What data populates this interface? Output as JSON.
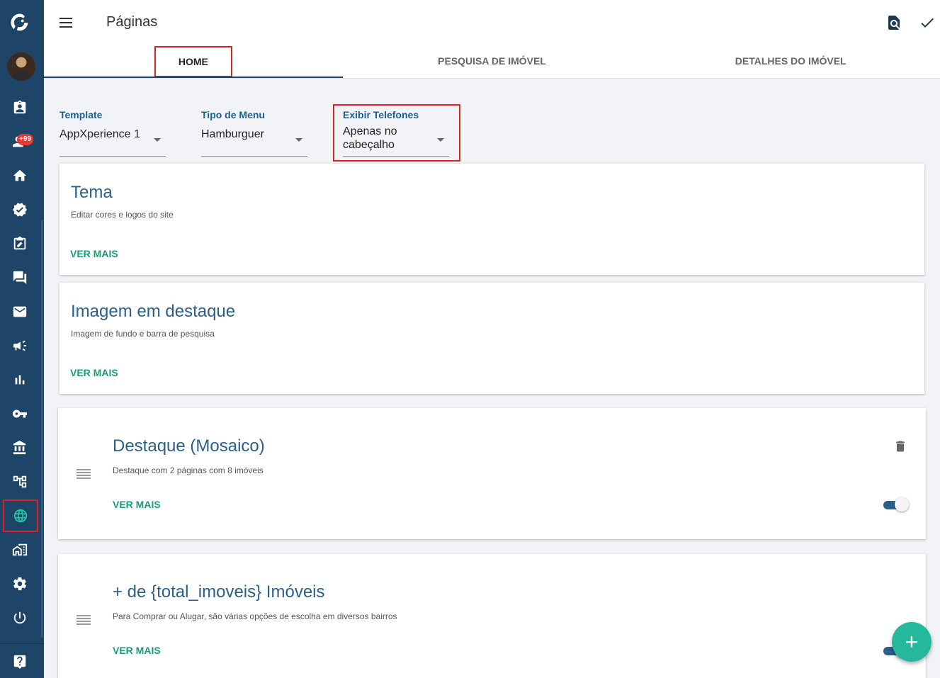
{
  "header": {
    "title": "Páginas"
  },
  "tabs": [
    {
      "label": "HOME",
      "active": true
    },
    {
      "label": "PESQUISA DE IMÓVEL",
      "active": false
    },
    {
      "label": "DETALHES DO IMÓVEL",
      "active": false
    }
  ],
  "sidebar": {
    "badge": "+99",
    "icons": [
      "logo-icon",
      "avatar",
      "contacts-icon",
      "leads-icon",
      "home-icon",
      "verified-icon",
      "edit-task-icon",
      "chat-icon",
      "mail-icon",
      "megaphone-icon",
      "chart-icon",
      "key-icon",
      "bank-icon",
      "hierarchy-icon",
      "globe-icon",
      "buildings-icon",
      "settings-icon",
      "power-icon",
      "help-icon"
    ]
  },
  "selects": {
    "template": {
      "label": "Template",
      "value": "AppXperience 1"
    },
    "menu_type": {
      "label": "Tipo de Menu",
      "value": "Hamburguer"
    },
    "phones": {
      "label": "Exibir Telefones",
      "value_line1": "Apenas no",
      "value_line2": "cabeçalho"
    }
  },
  "cards": {
    "tema": {
      "title": "Tema",
      "desc": "Editar cores e logos do site",
      "more": "VER MAIS"
    },
    "imagem": {
      "title": "Imagem em destaque",
      "desc": "Imagem de fundo e barra de pesquisa",
      "more": "VER MAIS"
    },
    "mosaico": {
      "title": "Destaque (Mosaico)",
      "desc": "Destaque com 2 páginas com 8 imóveis",
      "more": "VER MAIS",
      "enabled": true
    },
    "total": {
      "title": "+ de {total_imoveis} Imóveis",
      "desc": "Para Comprar ou Alugar, são várias opções de escolha em diversos bairros",
      "more": "VER MAIS",
      "enabled": true
    }
  },
  "fab": {
    "symbol": "+"
  },
  "colors": {
    "sidebar": "#1e4467",
    "accent": "#26c6a8",
    "title": "#2b5f8a",
    "link": "#1a9c78",
    "highlight": "#e02020"
  }
}
